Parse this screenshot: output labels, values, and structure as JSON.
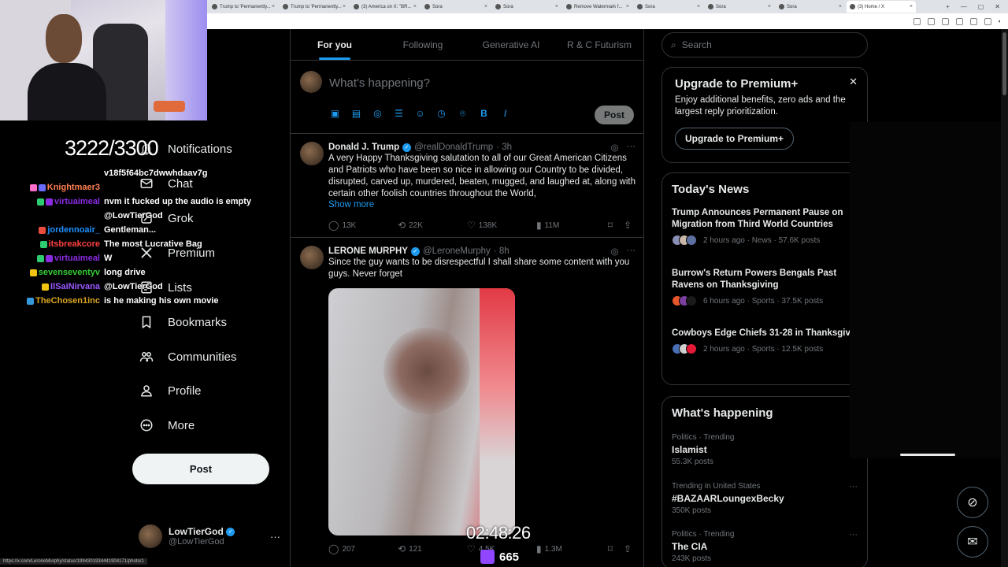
{
  "browser": {
    "tabs": [
      {
        "label": "Trump to 'Permanently..."
      },
      {
        "label": "Trump to 'Permanently..."
      },
      {
        "label": "(3) America on X: \"BR..."
      },
      {
        "label": "Sora"
      },
      {
        "label": "Sora"
      },
      {
        "label": "Remove Watermark f..."
      },
      {
        "label": "Sora"
      },
      {
        "label": "Sora"
      },
      {
        "label": "Sora"
      },
      {
        "label": "(3) Home / X"
      }
    ],
    "status_url": "https://x.com/LeroneMurphy/status/1994301934441904171/photo/1"
  },
  "nav": {
    "items": [
      {
        "label": "Notifications",
        "icon": "bell-icon"
      },
      {
        "label": "Chat",
        "icon": "mail-icon"
      },
      {
        "label": "Grok",
        "icon": "grok-icon"
      },
      {
        "label": "Premium",
        "icon": "x-logo-icon"
      },
      {
        "label": "Lists",
        "icon": "list-icon"
      },
      {
        "label": "Bookmarks",
        "icon": "bookmark-icon"
      },
      {
        "label": "Communities",
        "icon": "communities-icon"
      },
      {
        "label": "Profile",
        "icon": "profile-icon"
      },
      {
        "label": "More",
        "icon": "more-circle-icon"
      }
    ],
    "post_label": "Post",
    "account": {
      "name": "LowTierGod",
      "handle": "@LowTierGod"
    }
  },
  "stream": {
    "counter": "3222/3300",
    "timer": "02:48:26",
    "viewers": "665",
    "chat": [
      {
        "user": "",
        "message": "v18f5f64bc7dwwhdaav7g",
        "color": "#ffffff"
      },
      {
        "user": "Knightmaer3",
        "message": "",
        "color": "#ff7f50"
      },
      {
        "user": "virtuaimeal",
        "message": "nvm it fucked up the audio is empty",
        "color": "#8a2be2"
      },
      {
        "user": "",
        "message": "@LowTierGod",
        "color": "#ffffff"
      },
      {
        "user": "jordennoair_",
        "message": "Gentleman...",
        "color": "#1e90ff"
      },
      {
        "user": "itsbreakcore",
        "message": "The most Lucrative Bag",
        "color": "#ff4040"
      },
      {
        "user": "virtuaimeal",
        "message": "W",
        "color": "#8a2be2"
      },
      {
        "user": "sevenseventyv",
        "message": "long drive",
        "color": "#32cd32"
      },
      {
        "user": "IlSaiNirvana",
        "message": "@LowTierGod",
        "color": "#9b59ff"
      },
      {
        "user": "TheChosen1inc",
        "message": "is he making his own movie",
        "color": "#daa520"
      }
    ]
  },
  "feed": {
    "tabs": [
      {
        "label": "For you",
        "active": true
      },
      {
        "label": "Following",
        "active": false
      },
      {
        "label": "Generative AI",
        "active": false
      },
      {
        "label": "R & C Futurism",
        "active": false
      }
    ],
    "composer_placeholder": "What's happening?",
    "composer_post": "Post",
    "tweets": [
      {
        "name": "Donald J. Trump",
        "handle": "@realDonaldTrump",
        "time": "· 3h",
        "text": "A very Happy Thanksgiving salutation to all of our Great American Citizens and Patriots who have been so nice in allowing our Country to be divided, disrupted, carved up, murdered, beaten, mugged, and laughed at, along with certain other foolish countries throughout the World,",
        "show_more": "Show more",
        "replies": "13K",
        "reposts": "22K",
        "likes": "138K",
        "views": "11M"
      },
      {
        "name": "LERONE MURPHY",
        "handle": "@LeroneMurphy",
        "time": "· 8h",
        "text": "Since the guy wants to be disrespectful I shall share some content with you guys. Never forget",
        "replies": "207",
        "reposts": "121",
        "likes": "4.5K",
        "views": "1.3M"
      }
    ]
  },
  "sidebar": {
    "search_placeholder": "Search",
    "premium": {
      "title": "Upgrade to Premium+",
      "body": "Enjoy additional benefits, zero ads and the largest reply prioritization.",
      "button": "Upgrade to Premium+"
    },
    "news": {
      "title": "Today's News",
      "items": [
        {
          "headline": "Trump Announces Permanent Pause on Migration from Third World Countries",
          "meta": "2 hours ago · News · 57.6K posts"
        },
        {
          "headline": "Burrow's Return Powers Bengals Past Ravens on Thanksgiving",
          "meta": "6 hours ago · Sports · 37.5K posts"
        },
        {
          "headline": "Cowboys Edge Chiefs 31-28 in Thanksgiving Thriller",
          "meta": "2 hours ago · Sports · 12.5K posts"
        }
      ]
    },
    "happening": {
      "title": "What's happening",
      "trends": [
        {
          "context": "Politics · Trending",
          "name": "Islamist",
          "posts": "55.3K posts"
        },
        {
          "context": "Trending in United States",
          "name": "#BAZAARLoungexBecky",
          "posts": "350K posts"
        },
        {
          "context": "Politics · Trending",
          "name": "The CIA",
          "posts": "243K posts"
        }
      ]
    }
  },
  "colors": {
    "accent": "#1d9bf0",
    "background": "#000000",
    "muted": "#71767b",
    "border": "#2f3336"
  }
}
